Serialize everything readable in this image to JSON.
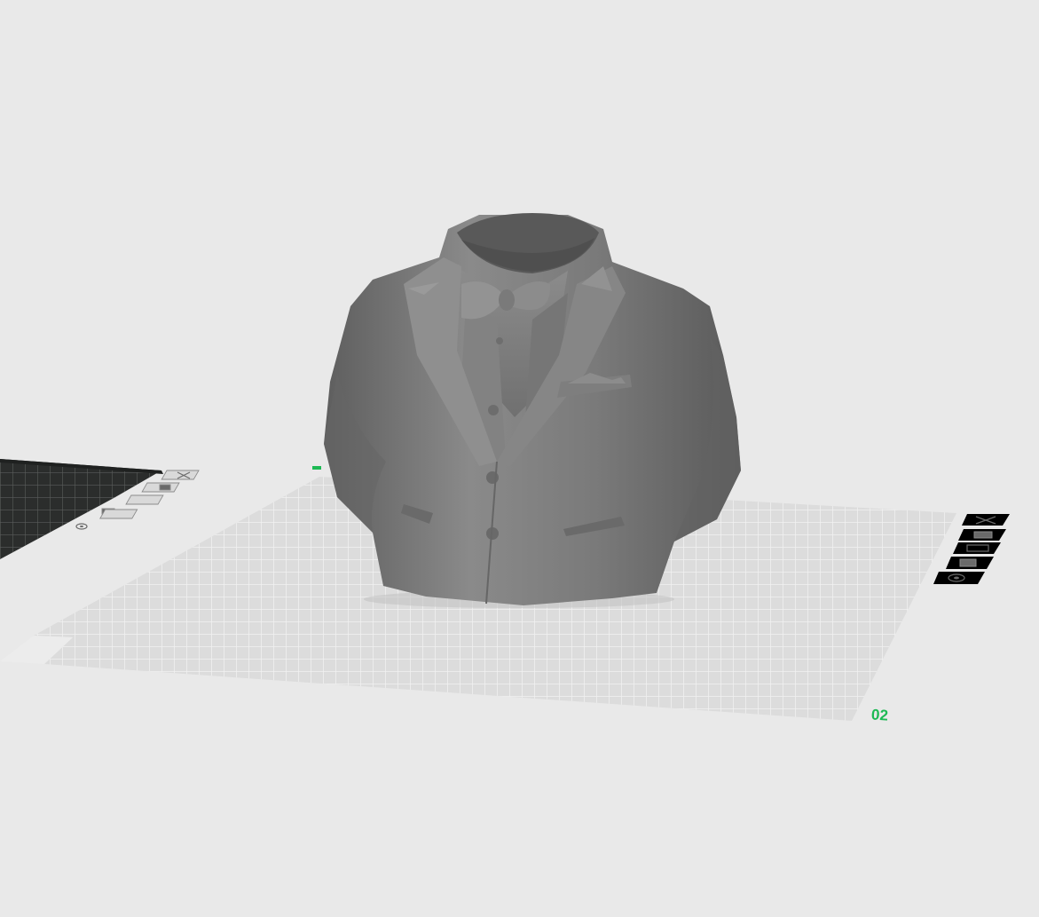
{
  "scene": {
    "background_color": "#e9e9e9",
    "model_color": "#7d7d7d",
    "model_name": "suit-bust",
    "accent_color": "#1db954"
  },
  "plates": [
    {
      "id": "plate-1",
      "state": "inactive",
      "bed_color": "#2b2d2c",
      "buttons": [
        "close-icon",
        "arrange-icon",
        "lock-icon",
        "settings-icon"
      ]
    },
    {
      "id": "plate-2",
      "state": "active",
      "bed_color": "#dcdcdc",
      "number_label": "02",
      "buttons": [
        "close-icon",
        "arrange-icon",
        "orient-icon",
        "lock-icon",
        "settings-icon"
      ]
    }
  ]
}
